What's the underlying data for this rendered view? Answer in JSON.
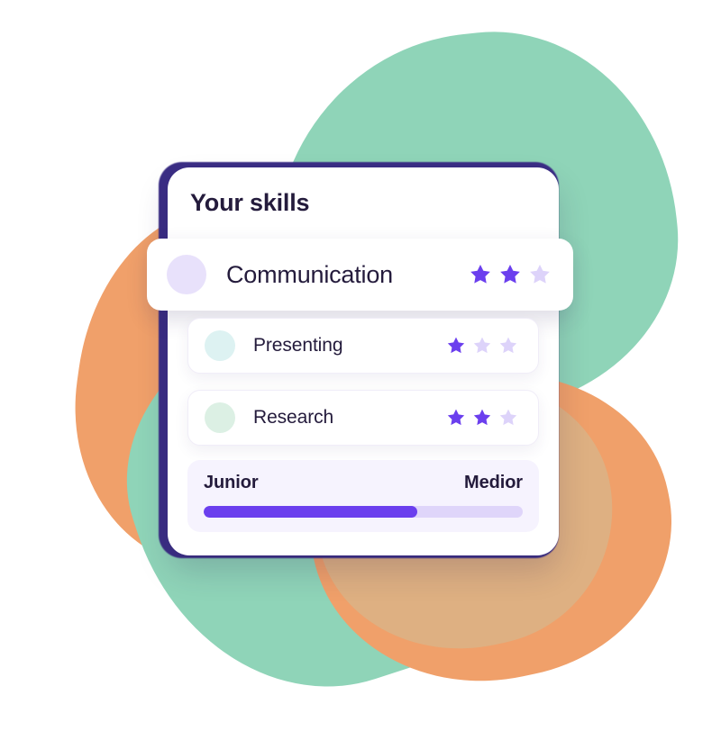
{
  "card": {
    "title": "Your skills"
  },
  "featured_skill": {
    "label": "Communication",
    "avatar_color": "#E8E1FB",
    "rating": 2,
    "max_rating": 3
  },
  "sub_skills": [
    {
      "label": "Presenting",
      "avatar_color": "#DDF2F2",
      "rating": 1,
      "max_rating": 3
    },
    {
      "label": "Research",
      "avatar_color": "#DCF0E4",
      "rating": 2,
      "max_rating": 3
    }
  ],
  "level": {
    "start_label": "Junior",
    "end_label": "Medior",
    "progress_percent": 67
  },
  "colors": {
    "star_filled": "#6B3FEE",
    "star_empty": "#DDD3FA",
    "progress_fill": "#6B3FEE",
    "progress_track": "#DFD5FA",
    "card_back": "#3B2E85",
    "text": "#241B3C",
    "blob_green": "#8FD4B8",
    "blob_orange": "#F0A06A"
  }
}
